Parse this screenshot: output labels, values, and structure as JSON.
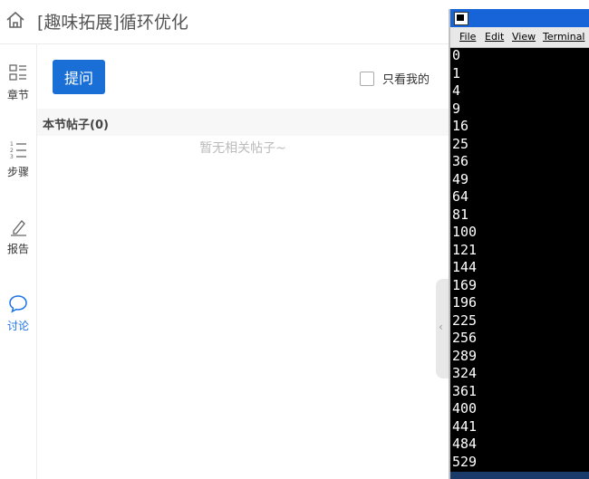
{
  "header": {
    "title": "[趣味拓展]循环优化"
  },
  "sidebar": {
    "items": [
      {
        "label": "章节",
        "icon": "chapters-icon"
      },
      {
        "label": "步骤",
        "icon": "steps-icon"
      },
      {
        "label": "报告",
        "icon": "report-icon"
      },
      {
        "label": "讨论",
        "icon": "discussion-icon",
        "active": true
      }
    ]
  },
  "discussion": {
    "ask_button": "提问",
    "only_mine_label": "只看我的",
    "only_mine_checked": false,
    "posts_title": "本节帖子(0)",
    "empty_text": "暂无相关帖子~"
  },
  "terminal": {
    "menu": [
      "File",
      "Edit",
      "View",
      "Terminal"
    ],
    "output": [
      "0",
      "1",
      "4",
      "9",
      "16",
      "25",
      "36",
      "49",
      "64",
      "81",
      "100",
      "121",
      "144",
      "169",
      "196",
      "225",
      "256",
      "289",
      "324",
      "361",
      "400",
      "441",
      "484",
      "529"
    ]
  },
  "colors": {
    "accent": "#1a6fd6",
    "terminal_bg": "#000000",
    "titlebar": "#1664d8"
  }
}
